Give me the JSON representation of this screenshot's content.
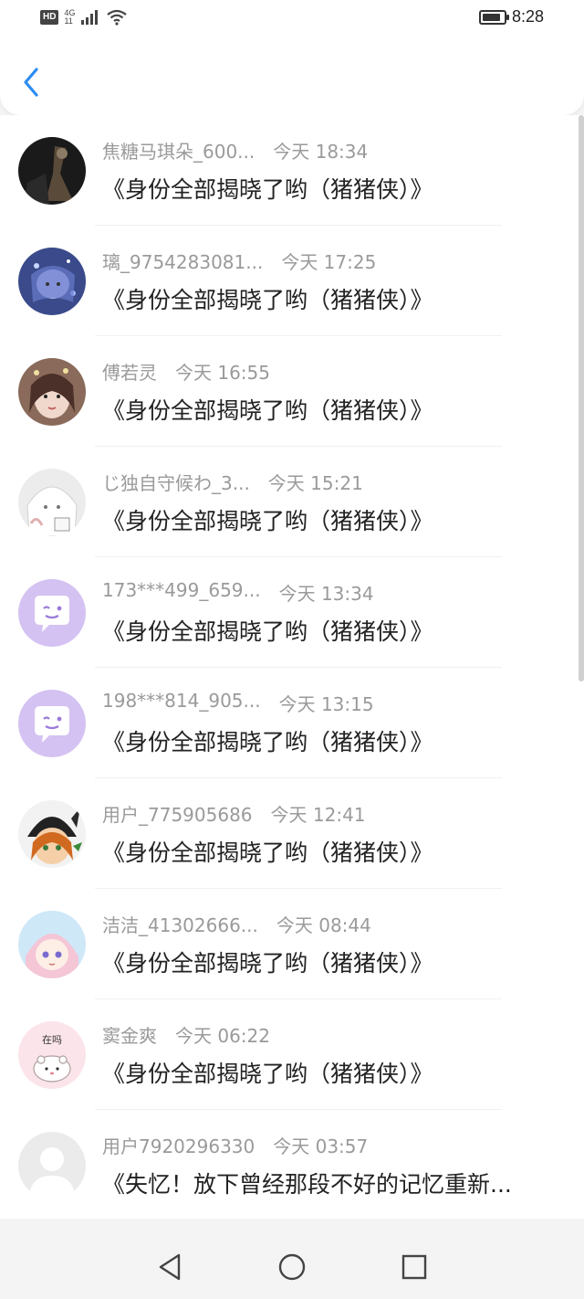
{
  "status_bar": {
    "hd": "HD",
    "network": "4G",
    "signal_sub": "11",
    "battery_level": 0.85,
    "time": "8:28"
  },
  "header": {
    "back_icon": "chevron-left-icon",
    "accent_color": "#2b8cf2"
  },
  "items": [
    {
      "name": "焦糖马琪朵_600...",
      "time": "今天 18:34",
      "title": "《身份全部揭晓了哟（猪猪侠）》",
      "avatar": "dark-photo"
    },
    {
      "name": "璃_9754283081...",
      "time": "今天 17:25",
      "title": "《身份全部揭晓了哟（猪猪侠）》",
      "avatar": "blue-anime"
    },
    {
      "name": "傅若灵",
      "time": "今天 16:55",
      "title": "《身份全部揭晓了哟（猪猪侠）》",
      "avatar": "girl-photo"
    },
    {
      "name": "じ独自守候わ_3...",
      "time": "今天 15:21",
      "title": "《身份全部揭晓了哟（猪猪侠）》",
      "avatar": "white-anime"
    },
    {
      "name": "173***499_659...",
      "time": "今天 13:34",
      "title": "《身份全部揭晓了哟（猪猪侠）》",
      "avatar": "purple-chat"
    },
    {
      "name": "198***814_905...",
      "time": "今天 13:15",
      "title": "《身份全部揭晓了哟（猪猪侠）》",
      "avatar": "purple-chat"
    },
    {
      "name": "用户_775905686",
      "time": "今天 12:41",
      "title": "《身份全部揭晓了哟（猪猪侠）》",
      "avatar": "fox-girl"
    },
    {
      "name": "洁洁_41302666...",
      "time": "今天 08:44",
      "title": "《身份全部揭晓了哟（猪猪侠）》",
      "avatar": "pink-anime"
    },
    {
      "name": "窦金爽",
      "time": "今天 06:22",
      "title": "《身份全部揭晓了哟（猪猪侠）》",
      "avatar": "hamster",
      "avatar_text": "在吗"
    },
    {
      "name": "用户7920296330",
      "time": "今天 03:57",
      "title": "《失忆！放下曾经那段不好的记忆重新...",
      "avatar": "default-gray"
    }
  ],
  "nav": {
    "back_icon": "triangle-back-icon",
    "home_icon": "circle-home-icon",
    "recent_icon": "square-recent-icon"
  }
}
